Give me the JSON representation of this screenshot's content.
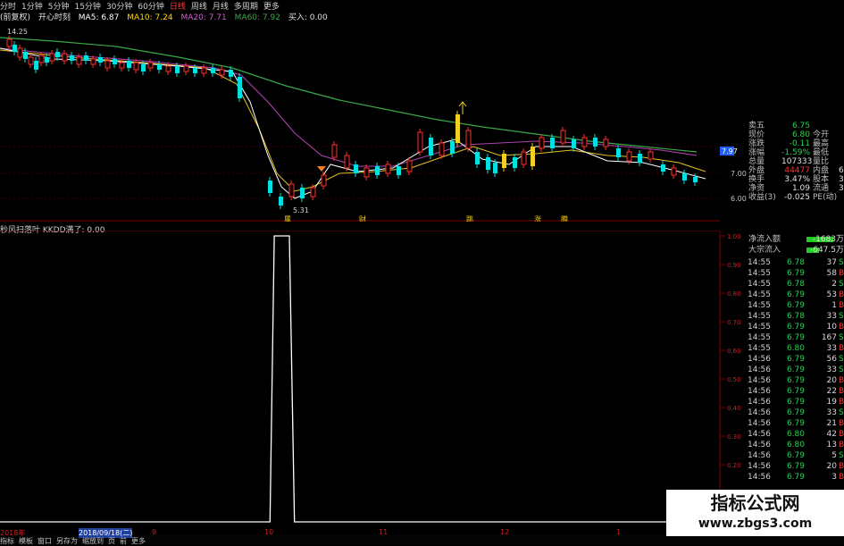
{
  "colors": {
    "up": "#ff3030",
    "down": "#00e0e0",
    "green": "#22cc22",
    "ma5": "#ffffff",
    "ma10": "#ffd700",
    "ma20": "#c040c0",
    "ma60": "#3aa84a",
    "yellow": "#f0d020"
  },
  "period_bar": {
    "items": [
      "分时",
      "1分钟",
      "5分钟",
      "15分钟",
      "30分钟",
      "60分钟",
      "日线",
      "周线",
      "月线",
      "多周期",
      "更多"
    ],
    "active_index": 6
  },
  "ma_bar": {
    "title": "(前复权)",
    "indicator": "开心时刻",
    "ma5": "MA5: 6.87",
    "ma10": "MA10: 7.24",
    "ma20": "MA20: 7.71",
    "ma60": "MA60: 7.92",
    "buy": "买入: 0.00"
  },
  "main": {
    "high_label": "14.25",
    "low_label": "5.31",
    "marker_labels": [
      "属",
      "财",
      "跳",
      "涨",
      "腾"
    ],
    "price_scale": [
      "7.97",
      "7.00",
      "6.00"
    ]
  },
  "indicator": {
    "title": "秒风扫落叶 KKDD满了: 0.00",
    "scale": [
      "1.00",
      "0.90",
      "0.80",
      "0.70",
      "0.60",
      "0.50",
      "0.40",
      "0.30",
      "0.20",
      "0.10"
    ],
    "chart_data": {
      "type": "line",
      "name": "KKDD满了",
      "x_range": [
        0,
        100
      ],
      "ylim": [
        0,
        1
      ],
      "x": [
        0,
        37.5,
        38.1,
        40.2,
        40.9,
        100
      ],
      "y": [
        0,
        0,
        1,
        1,
        0,
        0
      ]
    }
  },
  "bottom_bar": {
    "items": [
      "2018年",
      "2018/09/18(二)",
      "9",
      "10",
      "11",
      "12",
      "1"
    ],
    "tabs": [
      "指标",
      "模板",
      "窗口",
      "另存为",
      "缩放到",
      "页",
      "前",
      "更多"
    ]
  },
  "info_panel": {
    "rows": [
      {
        "label": "卖五",
        "value": "6.75",
        "label2": "",
        "value2": ""
      },
      {
        "label": "现价",
        "value": "6.80",
        "label2": "今开",
        "value2": ""
      },
      {
        "label": "涨跌",
        "value": "-0.11",
        "label2": "最高",
        "value2": ""
      },
      {
        "label": "涨幅",
        "value": "-1.59%",
        "label2": "最低",
        "value2": ""
      },
      {
        "label": "总量",
        "value": "107333",
        "label2": "量比",
        "value2": ""
      },
      {
        "label": "外盘",
        "value": "44477",
        "label2": "内盘",
        "value2": "6"
      },
      {
        "label": "换手",
        "value": "3.47%",
        "label2": "股本",
        "value2": "3."
      },
      {
        "label": "净资",
        "value": "1.09",
        "label2": "流通",
        "value2": "3."
      },
      {
        "label": "收益(3)",
        "value": "-0.025",
        "label2": "PE(动)",
        "value2": ""
      }
    ]
  },
  "flow": {
    "rows": [
      {
        "label": "净流入额",
        "value": "-1683万"
      },
      {
        "label": "大宗流入",
        "value": "-647.5万"
      }
    ]
  },
  "ticks": [
    {
      "t": "14:55",
      "p": "6.78",
      "v": "37",
      "s": "S"
    },
    {
      "t": "14:55",
      "p": "6.79",
      "v": "58",
      "s": "B"
    },
    {
      "t": "14:55",
      "p": "6.78",
      "v": "2",
      "s": "S"
    },
    {
      "t": "14:55",
      "p": "6.79",
      "v": "53",
      "s": "B"
    },
    {
      "t": "14:55",
      "p": "6.79",
      "v": "1",
      "s": "B"
    },
    {
      "t": "14:55",
      "p": "6.78",
      "v": "33",
      "s": "S"
    },
    {
      "t": "14:55",
      "p": "6.79",
      "v": "10",
      "s": "B"
    },
    {
      "t": "14:55",
      "p": "6.79",
      "v": "167",
      "s": "S"
    },
    {
      "t": "14:55",
      "p": "6.80",
      "v": "33",
      "s": "B"
    },
    {
      "t": "14:56",
      "p": "6.79",
      "v": "56",
      "s": "S"
    },
    {
      "t": "14:56",
      "p": "6.79",
      "v": "33",
      "s": "S"
    },
    {
      "t": "14:56",
      "p": "6.79",
      "v": "20",
      "s": "B"
    },
    {
      "t": "14:56",
      "p": "6.79",
      "v": "22",
      "s": "B"
    },
    {
      "t": "14:56",
      "p": "6.79",
      "v": "19",
      "s": "B"
    },
    {
      "t": "14:56",
      "p": "6.79",
      "v": "33",
      "s": "S"
    },
    {
      "t": "14:56",
      "p": "6.79",
      "v": "21",
      "s": "B"
    },
    {
      "t": "14:56",
      "p": "6.80",
      "v": "42",
      "s": "B"
    },
    {
      "t": "14:56",
      "p": "6.80",
      "v": "13",
      "s": "B"
    },
    {
      "t": "14:56",
      "p": "6.79",
      "v": "5",
      "s": "S"
    },
    {
      "t": "14:56",
      "p": "6.79",
      "v": "20",
      "s": "B"
    },
    {
      "t": "14:56",
      "p": "6.79",
      "v": "3",
      "s": "B"
    }
  ],
  "watermark": {
    "cn": "指标公式网",
    "url": "www.zbgs3.com"
  }
}
